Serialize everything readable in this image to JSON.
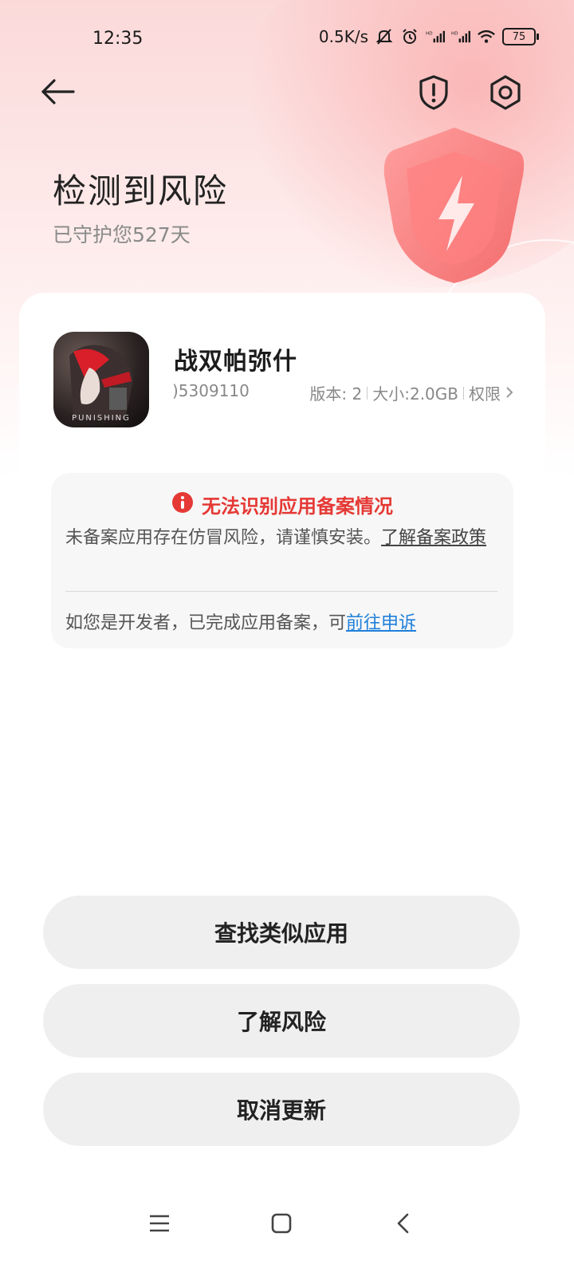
{
  "status_bar": {
    "time": "12:35",
    "net_speed": "0.5K/s",
    "battery": "75",
    "icons": [
      "mute-icon",
      "alarm-icon",
      "signal-hd-icon",
      "signal-hd-icon",
      "wifi-icon",
      "battery-icon"
    ]
  },
  "header": {
    "back_icon": "arrow-left-icon",
    "report_icon": "shield-alert-icon",
    "settings_icon": "gear-icon",
    "title": "检测到风险",
    "subtitle": "已守护您527天"
  },
  "app": {
    "name": "战双帕弥什",
    "id_fragment": ")5309110",
    "version_label": "版本: 2",
    "size_label": "大小:2.0GB",
    "permission_label": "权限",
    "icon_text": "PUNISHING"
  },
  "warning": {
    "title": "无法识别应用备案情况",
    "text": "未备案应用存在仿冒风险，请谨慎安装。",
    "policy_link": "了解备案政策",
    "dev_text": "如您是开发者，已完成应用备案，可",
    "appeal_link": "前往申诉"
  },
  "actions": {
    "find_similar": "查找类似应用",
    "learn_risk": "了解风险",
    "cancel_update": "取消更新"
  },
  "colors": {
    "accent_red": "#e53935",
    "link_blue": "#1e7fdb",
    "hero_pink": "#fbd9d9"
  },
  "nav": {
    "menu_icon": "menu-icon",
    "home_icon": "home-icon",
    "back_icon": "back-chevron-icon"
  }
}
